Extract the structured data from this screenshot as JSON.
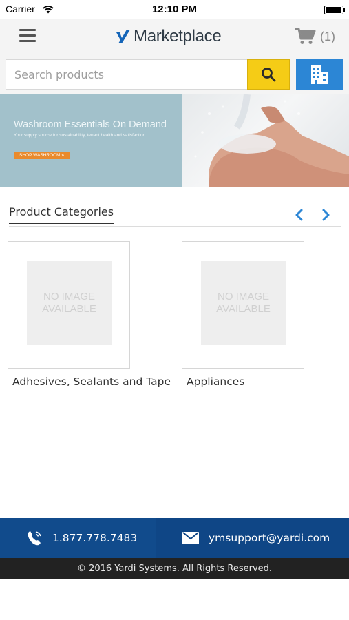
{
  "status_bar": {
    "carrier": "Carrier",
    "time": "12:10 PM"
  },
  "header": {
    "logo_text": "Marketplace",
    "cart_count": "(1)"
  },
  "search": {
    "placeholder": "Search products"
  },
  "banner": {
    "title": "Washroom Essentials On Demand",
    "subtitle": "Your supply source for sustainability, tenant health and satisfaction.",
    "cta": "SHOP WASHROOM »"
  },
  "categories": {
    "title": "Product Categories",
    "no_image_line1": "NO IMAGE",
    "no_image_line2": "AVAILABLE",
    "items": [
      {
        "label": "Adhesives, Sealants and Tape"
      },
      {
        "label": "Appliances"
      }
    ]
  },
  "contact": {
    "phone": "1.877.778.7483",
    "email": "ymsupport@yardi.com"
  },
  "footer": {
    "copyright": "© 2016 Yardi Systems. All Rights Reserved."
  },
  "colors": {
    "search_button": "#f5cc16",
    "building_button": "#2c86d5",
    "contact_bar": "#114b8c",
    "footer": "#222222",
    "banner_left": "#a2c1cb"
  }
}
